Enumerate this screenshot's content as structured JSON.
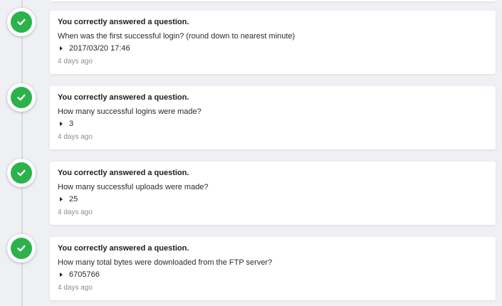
{
  "entries": [
    {
      "title": "You correctly answered a question.",
      "question": "When was the first successful login? (round down to nearest minute)",
      "answer": "2017/03/20 17:46",
      "time": "4 days ago",
      "status_color": "#2cb24b",
      "icon": "check-icon"
    },
    {
      "title": "You correctly answered a question.",
      "question": "How many successful logins were made?",
      "answer": "3",
      "time": "4 days ago",
      "status_color": "#2cb24b",
      "icon": "check-icon"
    },
    {
      "title": "You correctly answered a question.",
      "question": "How many successful uploads were made?",
      "answer": "25",
      "time": "4 days ago",
      "status_color": "#2cb24b",
      "icon": "check-icon"
    },
    {
      "title": "You correctly answered a question.",
      "question": "How many total bytes were downloaded from the FTP server?",
      "answer": "6705766",
      "time": "4 days ago",
      "status_color": "#2cb24b",
      "icon": "check-icon"
    }
  ]
}
